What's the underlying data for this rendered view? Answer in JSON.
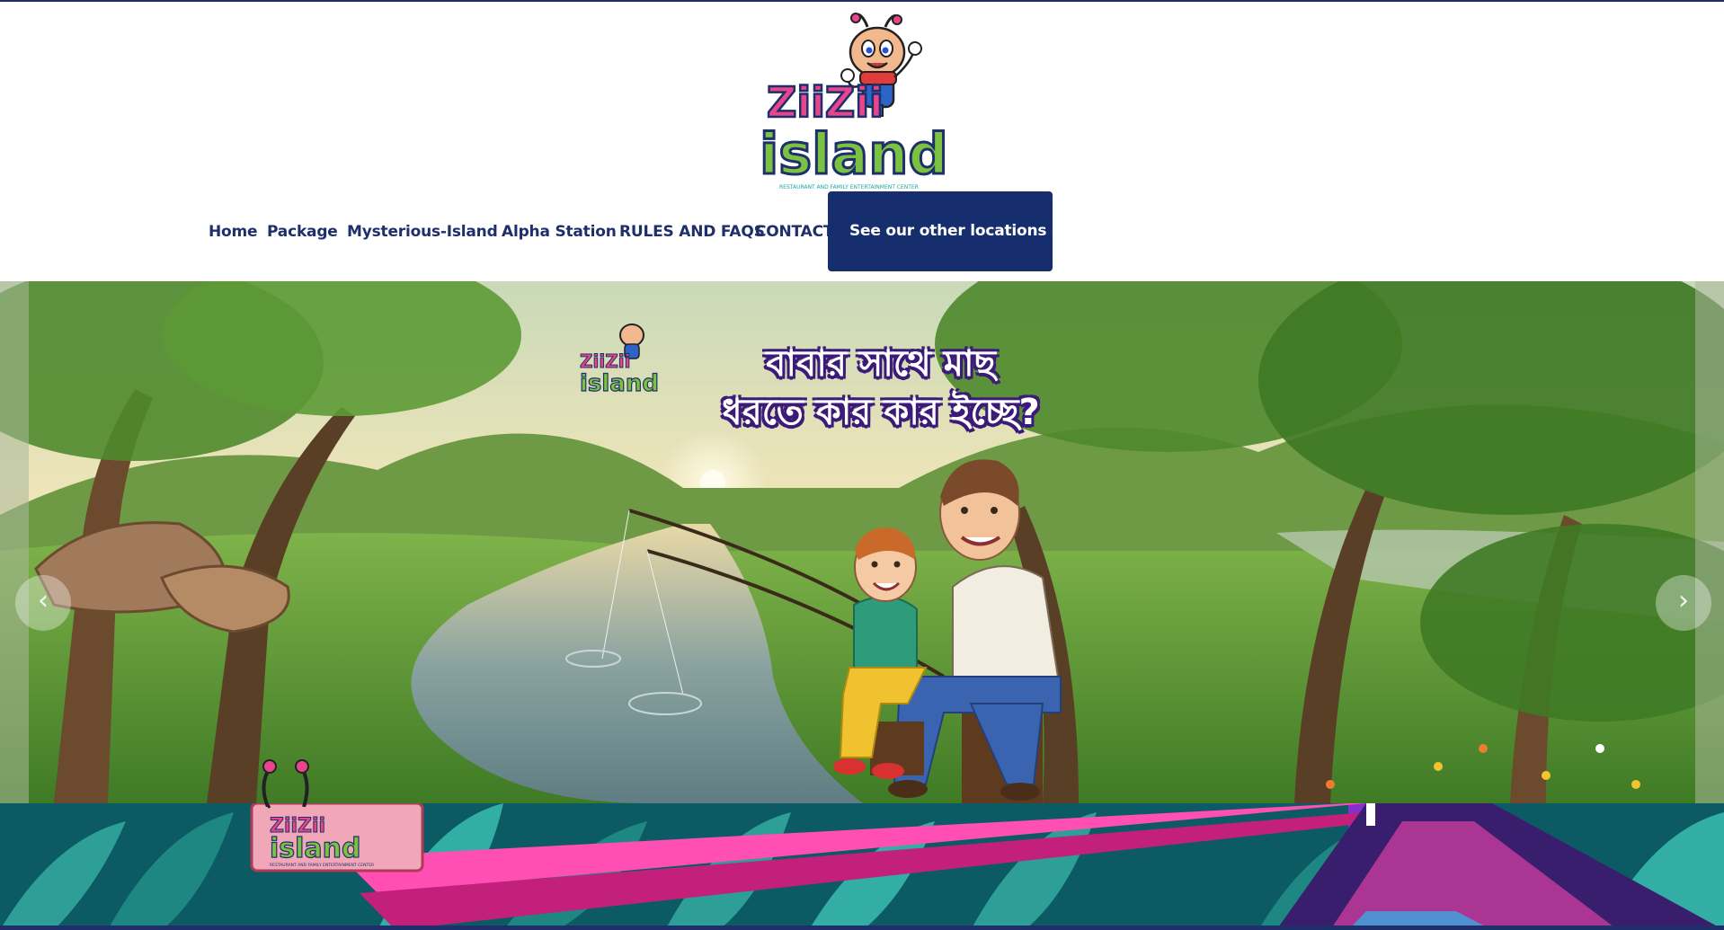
{
  "logo": {
    "line1": "ZiiZii",
    "line2": "island",
    "tagline": "RESTAURANT AND FAMILY ENTERTAINMENT CENTER"
  },
  "nav": {
    "items": [
      "Home",
      "Package",
      "Mysterious-Island",
      "Alpha Station",
      "RULES AND FAQS",
      "CONTACT"
    ],
    "cta_label": "See our other locations",
    "cta_chevron": "⌵"
  },
  "slider": {
    "headline_line1": "বাবার সাথে মাছ",
    "headline_line2": "ধরতে কার কার ইচ্ছে?",
    "prev_arrow": "‹",
    "next_arrow": "›",
    "badge_line1": "ZiiZii",
    "badge_line2": "island"
  },
  "section2": {
    "sign_line1": "ZiiZii",
    "sign_line2": "island",
    "sign_tagline": "RESTAURANT AND FAMILY ENTERTAINMENT CENTER"
  },
  "colors": {
    "navy": "#1f2f6b",
    "cta_bg": "#162d6e",
    "logo_pink": "#e8458c",
    "logo_green": "#7cc242",
    "logo_blue": "#2b8fd6"
  },
  "icons": [
    "zizi-mascot-icon",
    "chevron-down-icon",
    "arrow-left-icon",
    "arrow-right-icon"
  ]
}
